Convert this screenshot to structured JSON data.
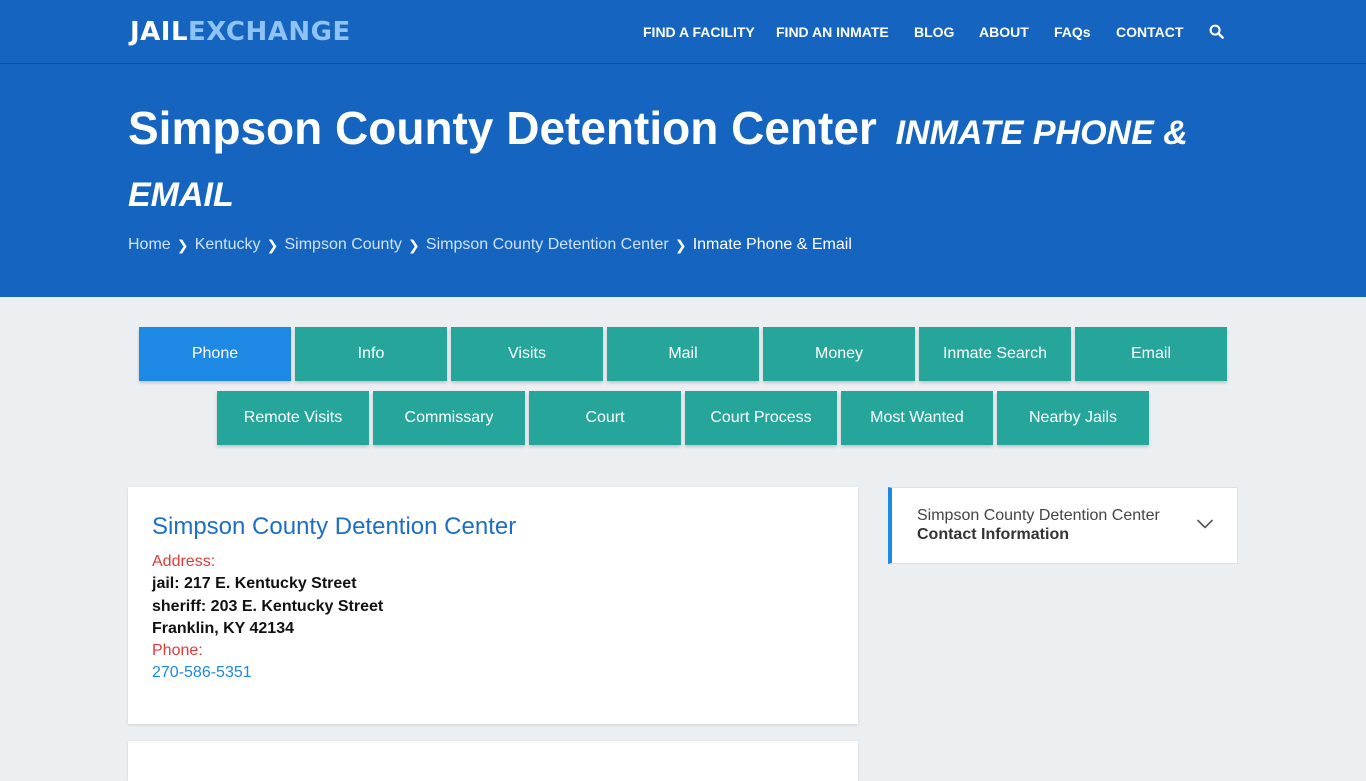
{
  "logo": {
    "part1": "JAIL",
    "part2": "EXCHANGE"
  },
  "nav": {
    "items": [
      "FIND A FACILITY",
      "FIND AN INMATE",
      "BLOG",
      "ABOUT",
      "FAQs",
      "CONTACT"
    ],
    "search_icon": "search-icon"
  },
  "hero": {
    "title": "Simpson County Detention Center",
    "subtitle": "INMATE PHONE & EMAIL"
  },
  "breadcrumb": {
    "items": [
      "Home",
      "Kentucky",
      "Simpson County",
      "Simpson County Detention Center"
    ],
    "current": "Inmate Phone & Email"
  },
  "tabs": {
    "active": "Phone",
    "row1": [
      "Phone",
      "Info",
      "Visits",
      "Mail",
      "Money",
      "Inmate Search",
      "Email"
    ],
    "row2": [
      "Remote Visits",
      "Commissary",
      "Court",
      "Court Process",
      "Most Wanted",
      "Nearby Jails"
    ]
  },
  "facility_card": {
    "title": "Simpson County Detention Center",
    "address_label": "Address:",
    "address_lines": [
      "jail: 217 E. Kentucky Street",
      "sheriff: 203 E. Kentucky Street",
      "Franklin, KY 42134"
    ],
    "phone_label": "Phone:",
    "phone": "270-586-5351"
  },
  "sidebar": {
    "line1": "Simpson County Detention Center",
    "line2": "Contact Information"
  },
  "colors": {
    "header_blue": "#1565c0",
    "tab_teal": "#26a69a",
    "tab_active_blue": "#1e88e5",
    "link_blue": "#1e88e5",
    "label_red": "#e53935",
    "page_bg": "#ebeff2"
  }
}
